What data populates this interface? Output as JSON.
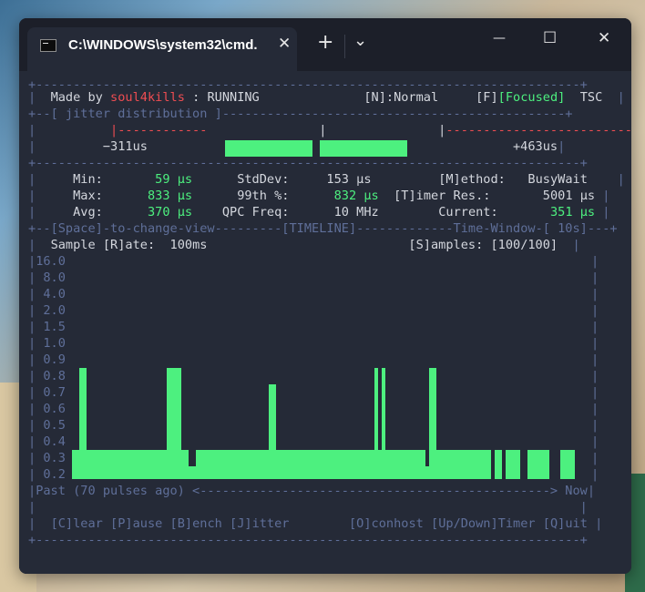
{
  "window": {
    "tab_title": "C:\\WINDOWS\\system32\\cmd.",
    "tab_close": "✕",
    "new_tab": "+",
    "dropdown": "⌄",
    "minimize": "—",
    "maximize": "☐",
    "close": "✕"
  },
  "header": {
    "made_by_label": "Made by ",
    "author": "soul4kills",
    "status_sep": " : ",
    "status": "RUNNING",
    "normal_key": "[N]:Normal",
    "focus_key": "[F]",
    "focus_value": "[Focused]",
    "tsc": "TSC"
  },
  "jitter": {
    "title": "[ jitter distribution ]",
    "min_label": "−311us",
    "max_label": "+463us"
  },
  "stats": {
    "min_label": "Min:",
    "min_value": "59 µs",
    "max_label": "Max:",
    "max_value": "833 µs",
    "avg_label": "Avg:",
    "avg_value": "370 µs",
    "stddev_label": "StdDev:",
    "stddev_value": "153 µs",
    "p99_label": "99th %:",
    "p99_value": "832 µs",
    "qpc_label": "QPC Freq:",
    "qpc_value": "10 MHz",
    "method_label": "[M]ethod:",
    "method_value": "BusyWait",
    "timer_label": "[T]imer Res.:",
    "timer_value": "5001 µs",
    "current_label": "Current:",
    "current_value": "351 µs"
  },
  "view_bar": {
    "space_hint": "[Space]-to-change-view",
    "view_name": "[TIMELINE]",
    "time_window": "Time-Window-[ 10s]"
  },
  "sample": {
    "rate_label": "Sample [R]ate:",
    "rate_value": "100ms",
    "samples_label": "[S]amples:",
    "samples_value": "[100/100]"
  },
  "chart_data": {
    "type": "bar",
    "y_tick_labels": [
      "16.0",
      "8.0",
      "4.0",
      "2.0",
      "1.5",
      "1.0",
      "0.9",
      "0.8",
      "0.7",
      "0.6",
      "0.5",
      "0.4",
      "0.3",
      "0.2"
    ],
    "values": [
      0.3,
      0.3,
      0.85,
      0.85,
      0.3,
      0.3,
      0.3,
      0.3,
      0.3,
      0.3,
      0.3,
      0.3,
      0.3,
      0.3,
      0.3,
      0.3,
      0.3,
      0.3,
      0.3,
      0.3,
      0.3,
      0.3,
      0.3,
      0.3,
      0.3,
      0.3,
      0.85,
      0.85,
      0.85,
      0.85,
      0.3,
      0.3,
      0.25,
      0.25,
      0.3,
      0.3,
      0.3,
      0.3,
      0.3,
      0.3,
      0.3,
      0.3,
      0.3,
      0.3,
      0.3,
      0.3,
      0.3,
      0.3,
      0.3,
      0.3,
      0.3,
      0.3,
      0.3,
      0.3,
      0.75,
      0.75,
      0.3,
      0.3,
      0.3,
      0.3,
      0.3,
      0.3,
      0.3,
      0.3,
      0.3,
      0.3,
      0.3,
      0.3,
      0.3,
      0.3,
      0.3,
      0.3,
      0.3,
      0.3,
      0.3,
      0.3,
      0.3,
      0.3,
      0.3,
      0.3,
      0.3,
      0.3,
      0.3,
      0.85,
      0.3,
      0.85,
      0.3,
      0.3,
      0.3,
      0.3,
      0.3,
      0.3,
      0.3,
      0.3,
      0.3,
      0.3,
      0.3,
      0.25,
      0.85,
      0.85,
      0.3,
      0.3,
      0.3,
      0.3,
      0.3,
      0.3,
      0.3,
      0.3,
      0.3,
      0.3,
      0.3,
      0.3,
      0.3,
      0.3,
      0.3,
      0.0,
      0.3,
      0.3,
      0.0,
      0.3,
      0.3,
      0.3,
      0.3,
      0.0,
      0.0,
      0.3,
      0.3,
      0.3,
      0.3,
      0.3,
      0.3,
      0.0,
      0.0,
      0.0,
      0.3,
      0.3,
      0.3,
      0.3
    ],
    "x_left_label": "Past (70 pulses ago)",
    "x_right_label": "Now",
    "color": "#4df07f"
  },
  "footer": {
    "clear": "[C]lear",
    "pause": "[P]ause",
    "bench": "[B]ench",
    "jitter": "[J]itter",
    "conhost": "[O]conhost",
    "timer": "[Up/Down]Timer",
    "quit": "[Q]uit"
  }
}
